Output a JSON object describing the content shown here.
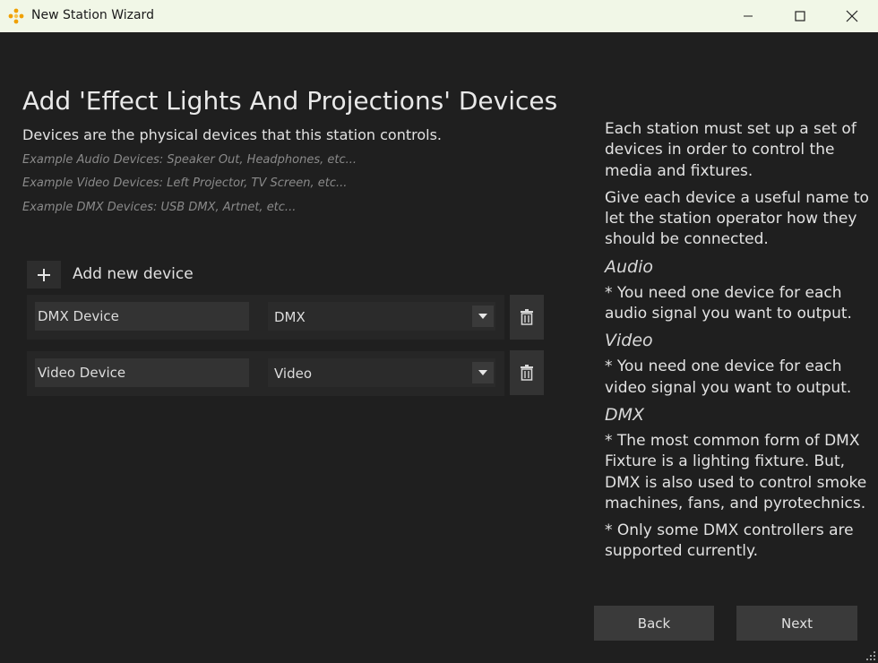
{
  "window": {
    "title": "New Station Wizard",
    "accent_color": "#f0a000",
    "titlebar_color": "#f1f7e7"
  },
  "page": {
    "heading": "Add 'Effect Lights And Projections' Devices",
    "subheading": "Devices are the physical devices that this station controls.",
    "examples": [
      "Example Audio Devices: Speaker Out, Headphones, etc...",
      "Example Video Devices: Left Projector, TV Screen, etc...",
      "Example DMX Devices: USB DMX, Artnet, etc..."
    ]
  },
  "devices": {
    "add_label": "Add new device",
    "rows": [
      {
        "name": "DMX Device",
        "type": "DMX"
      },
      {
        "name": "Video Device",
        "type": "Video"
      }
    ]
  },
  "help": {
    "intro_1": "Each station must set up a set of devices in order to control the media and fixtures.",
    "intro_2": "Give each device a useful name to let the station operator how they should be connected.",
    "audio_title": "Audio",
    "audio_text": "* You need one device for each audio signal you want to output.",
    "video_title": "Video",
    "video_text": "* You need one device for each video signal you want to output.",
    "dmx_title": "DMX",
    "dmx_text_1": "* The most common form of DMX Fixture is a lighting fixture. But, DMX is also used to control smoke machines, fans, and pyrotechnics.",
    "dmx_text_2": "* Only some DMX controllers are supported currently."
  },
  "footer": {
    "back_label": "Back",
    "next_label": "Next"
  }
}
